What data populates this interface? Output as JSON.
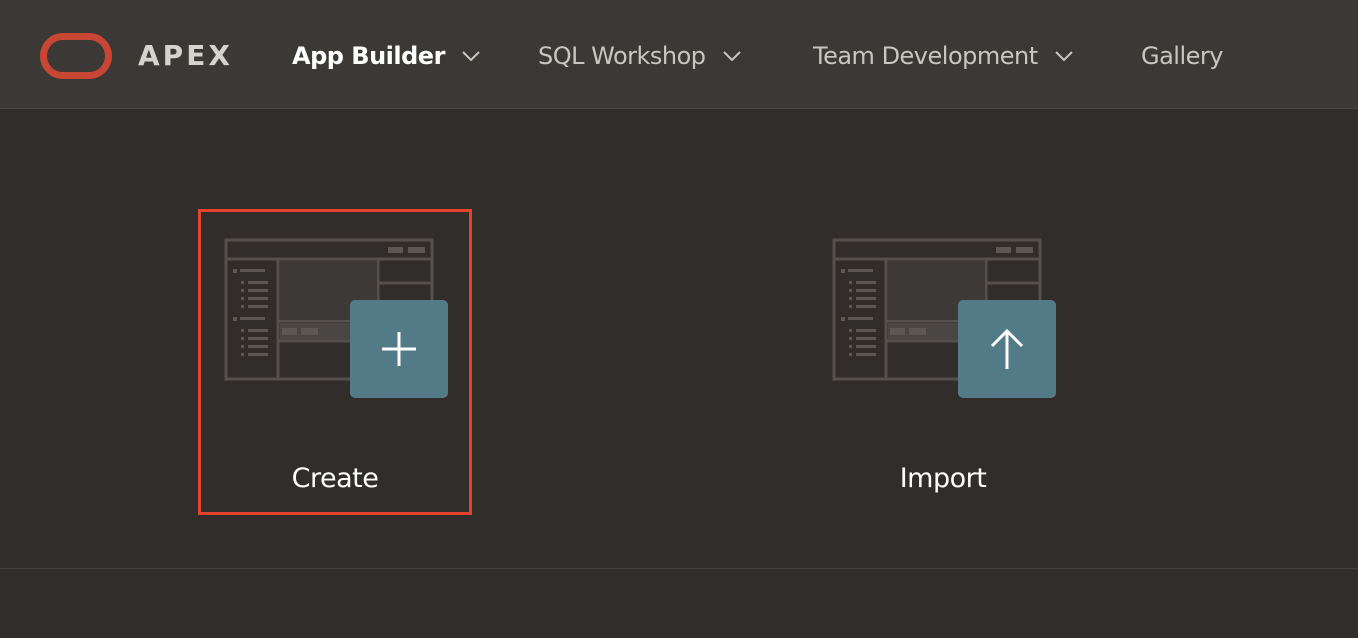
{
  "header": {
    "logo_text": "APEX",
    "nav": [
      {
        "label": "App Builder",
        "has_dropdown": true,
        "active": true
      },
      {
        "label": "SQL Workshop",
        "has_dropdown": true,
        "active": false
      },
      {
        "label": "Team Development",
        "has_dropdown": true,
        "active": false
      },
      {
        "label": "Gallery",
        "has_dropdown": false,
        "active": false
      }
    ]
  },
  "main": {
    "cards": [
      {
        "label": "Create",
        "icon": "plus-icon",
        "selected": true
      },
      {
        "label": "Import",
        "icon": "arrow-up-icon",
        "selected": false
      }
    ]
  },
  "colors": {
    "brand_red": "#c74634",
    "accent_teal": "#537a87",
    "selection_border": "#e2432a",
    "header_bg": "#3b3835",
    "page_bg": "#312d2a"
  }
}
